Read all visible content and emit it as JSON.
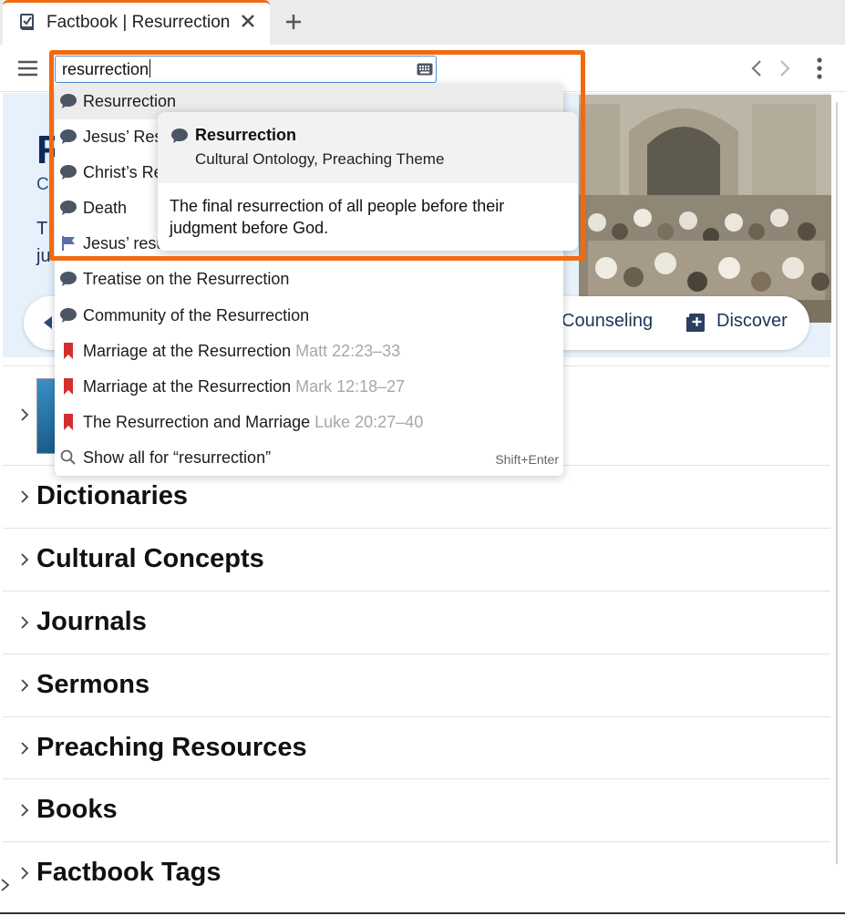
{
  "tab": {
    "title": "Factbook | Resurrection"
  },
  "search": {
    "value": "resurrection"
  },
  "dropdown": {
    "items": [
      {
        "label": "Resurrection",
        "ref": "",
        "icon": "speech-bubble-icon"
      },
      {
        "label": "Jesus’ Res",
        "ref": "",
        "icon": "speech-bubble-icon"
      },
      {
        "label": "Christ’s Re",
        "ref": "",
        "icon": "speech-bubble-icon"
      },
      {
        "label": "Death",
        "ref": "",
        "icon": "speech-bubble-icon"
      },
      {
        "label": "Jesus’ resu",
        "ref": "",
        "icon": "flag-icon"
      },
      {
        "label": "Treatise on the Resurrection",
        "ref": "",
        "icon": "speech-bubble-icon"
      },
      {
        "label": "Community of the Resurrection",
        "ref": "",
        "icon": "speech-bubble-icon"
      },
      {
        "label": "Marriage at the Resurrection",
        "ref": "Matt 22:23–33",
        "icon": "bookmark-icon"
      },
      {
        "label": "Marriage at the Resurrection",
        "ref": "Mark 12:18–27",
        "icon": "bookmark-icon"
      },
      {
        "label": "The Resurrection and Marriage",
        "ref": "Luke 20:27–40",
        "icon": "bookmark-icon"
      },
      {
        "label": "Show all for “resurrection”",
        "ref": "",
        "icon": "search-icon"
      }
    ],
    "shortcut": "Shift+Enter"
  },
  "preview": {
    "title": "Resurrection",
    "subtitle": "Cultural Ontology, Preaching Theme",
    "description": "The final resurrection of all people before their judgment before God."
  },
  "hero": {
    "letter": "R",
    "sub": "C",
    "desc_line1": "T",
    "desc_line2": "ju"
  },
  "actions": {
    "counseling": "Counseling",
    "discover": "Discover"
  },
  "sections": [
    "Dictionaries",
    "Cultural Concepts",
    "Journals",
    "Sermons",
    "Preaching Resources",
    "Books",
    "Factbook Tags"
  ],
  "colors": {
    "accent_orange": "#f26a0f",
    "bubble_gray": "#4b5566",
    "bookmark_red": "#d32f2f",
    "flag_blue": "#5b6fa8"
  }
}
